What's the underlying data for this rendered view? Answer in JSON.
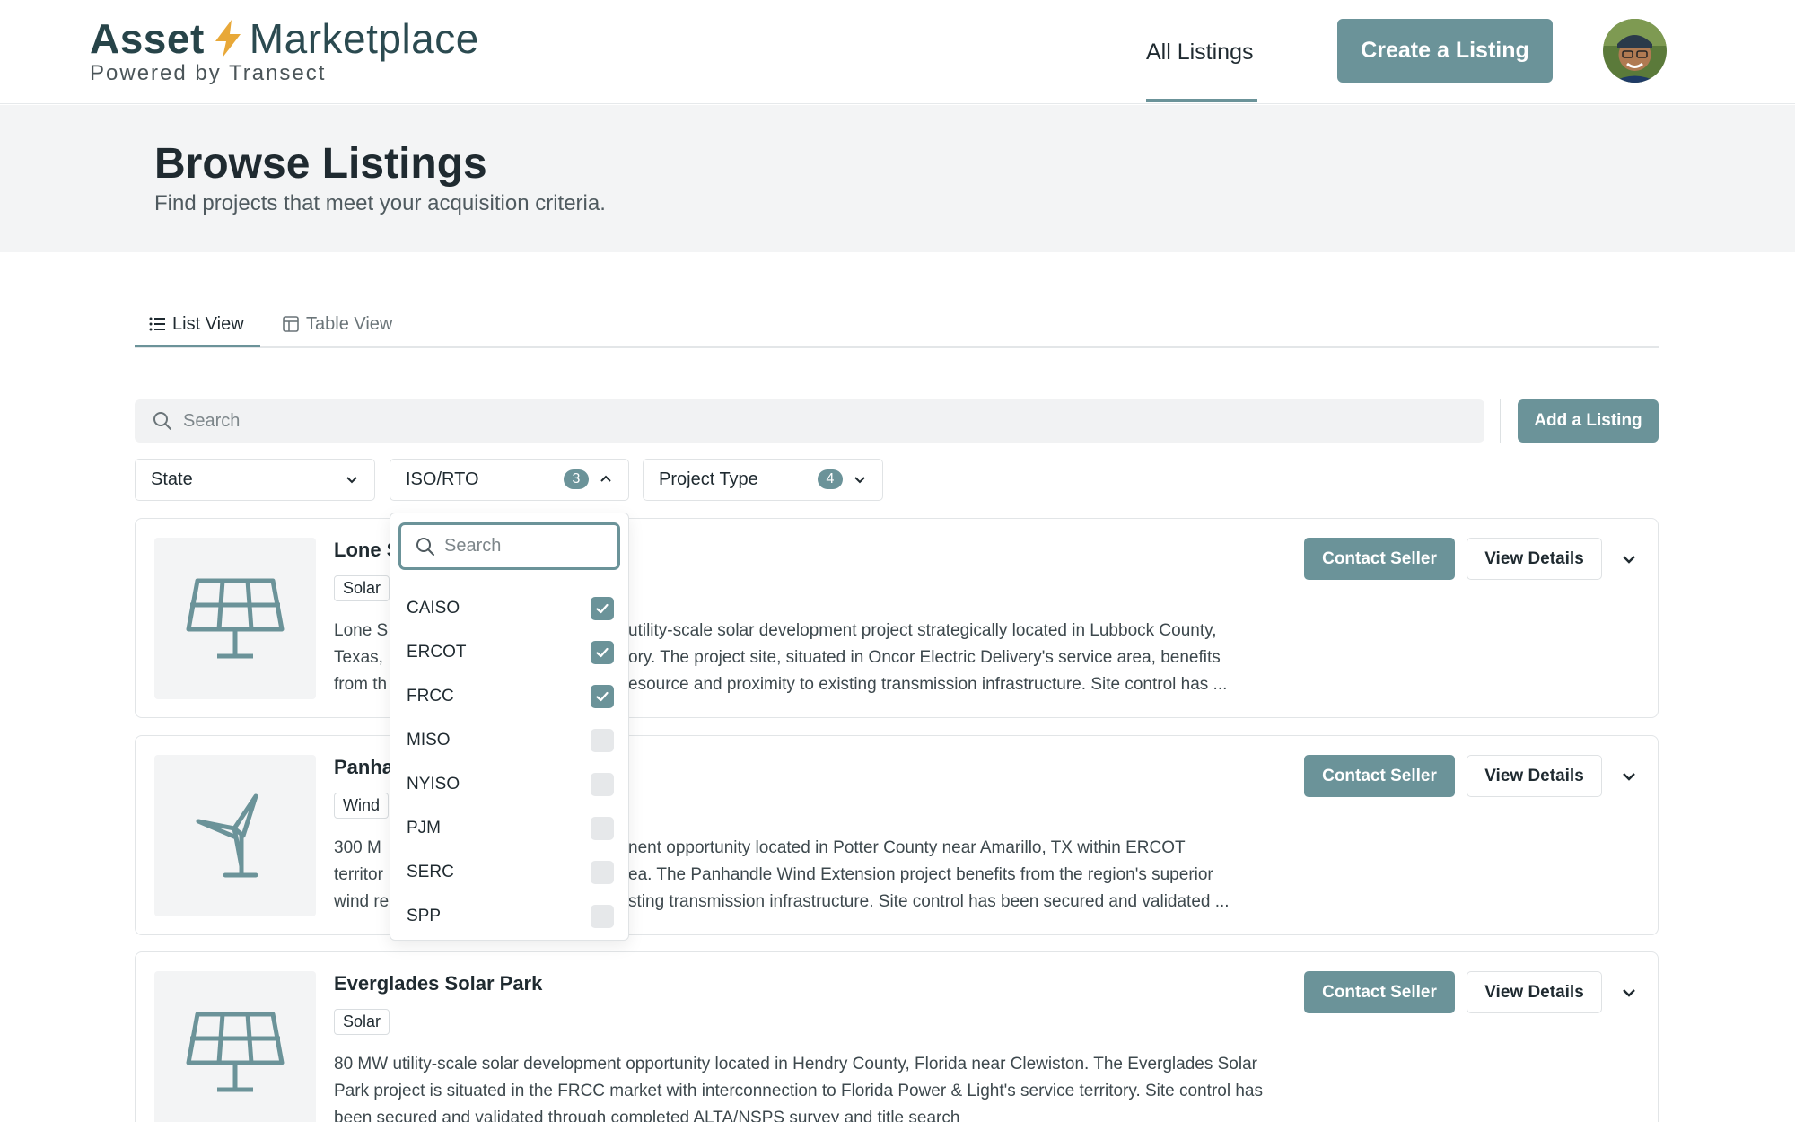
{
  "header": {
    "logo_asset": "Asset",
    "logo_marketplace": "Marketplace",
    "logo_sub": "Powered by Transect",
    "nav_all_listings": "All Listings",
    "create_button": "Create a Listing"
  },
  "hero": {
    "title": "Browse Listings",
    "subtitle": "Find projects that meet your acquisition criteria."
  },
  "tabs": {
    "list_view": "List View",
    "table_view": "Table View"
  },
  "search": {
    "placeholder": "Search"
  },
  "add_listing_button": "Add a Listing",
  "filters": {
    "state": {
      "label": "State"
    },
    "iso_rto": {
      "label": "ISO/RTO",
      "count": "3"
    },
    "project_type": {
      "label": "Project Type",
      "count": "4"
    }
  },
  "iso_dropdown": {
    "search_placeholder": "Search",
    "options": [
      {
        "label": "CAISO",
        "checked": true
      },
      {
        "label": "ERCOT",
        "checked": true
      },
      {
        "label": "FRCC",
        "checked": true
      },
      {
        "label": "MISO",
        "checked": false
      },
      {
        "label": "NYISO",
        "checked": false
      },
      {
        "label": "PJM",
        "checked": false
      },
      {
        "label": "SERC",
        "checked": false
      },
      {
        "label": "SPP",
        "checked": false
      }
    ]
  },
  "listings": [
    {
      "title": "Lone S",
      "tag": "Solar",
      "icon": "solar-panel-icon",
      "desc_left": [
        "Lone S",
        "Texas,",
        "from th"
      ],
      "desc_right": [
        "utility-scale solar development project strategically located in Lubbock County,",
        "ory. The project site, situated in Oncor Electric Delivery's service area, benefits",
        "esource and proximity to existing transmission infrastructure. Site control has ..."
      ]
    },
    {
      "title": "Panha",
      "tag": "Wind",
      "icon": "wind-turbine-icon",
      "desc_left": [
        "300 M",
        "territor",
        "wind re"
      ],
      "desc_right": [
        "nent opportunity located in Potter County near Amarillo, TX within ERCOT",
        "ea. The Panhandle Wind Extension project benefits from the region's superior",
        "sting transmission infrastructure. Site control has been secured and validated ..."
      ]
    },
    {
      "title": "Everglades Solar Park",
      "tag": "Solar",
      "icon": "solar-panel-icon",
      "desc": "80 MW utility-scale solar development opportunity located in Hendry County, Florida near Clewiston. The Everglades Solar Park project is situated in the FRCC market with interconnection to Florida Power & Light's service territory. Site control has been secured and validated through completed ALTA/NSPS survey and title search"
    }
  ],
  "card_buttons": {
    "contact": "Contact Seller",
    "view": "View Details"
  },
  "colors": {
    "accent": "#6b9399",
    "bolt": "#e8a838"
  }
}
